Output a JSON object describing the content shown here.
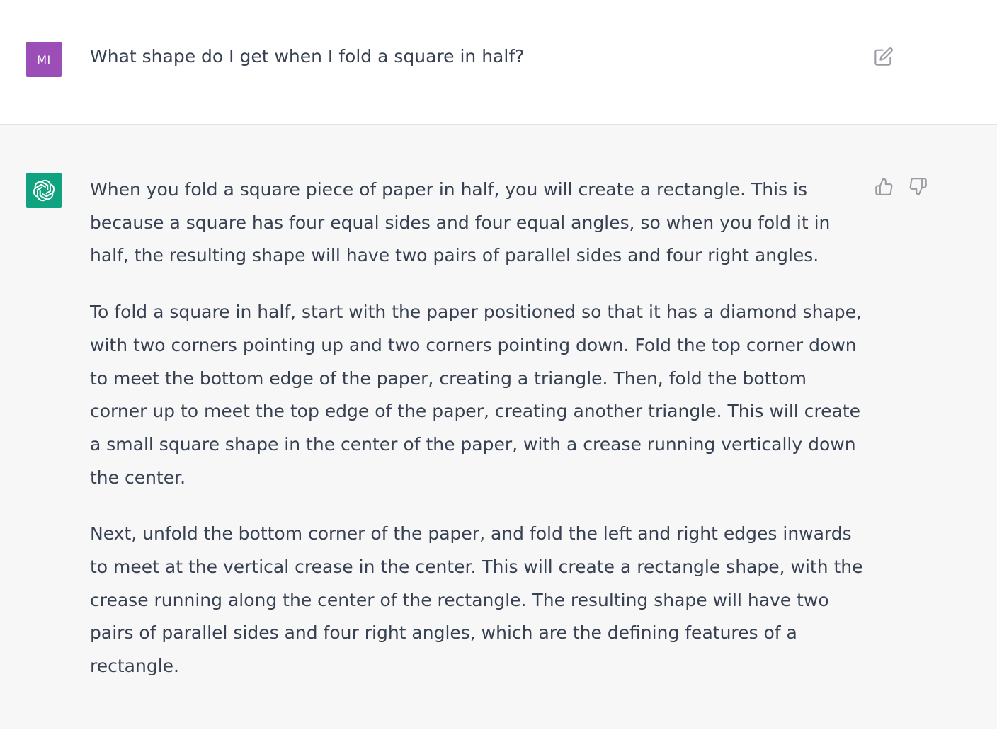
{
  "user_message": {
    "avatar_initials": "MI",
    "avatar_color": "#9b4fb6",
    "text": "What shape do I get when I fold a square in half?",
    "edit_icon": "edit-icon"
  },
  "assistant_message": {
    "avatar_color": "#10a37f",
    "avatar_icon": "openai-logo-icon",
    "paragraphs": [
      "When you fold a square piece of paper in half, you will create a rectangle. This is because a square has four equal sides and four equal angles, so when you fold it in half, the resulting shape will have two pairs of parallel sides and four right angles.",
      "To fold a square in half, start with the paper positioned so that it has a diamond shape, with two corners pointing up and two corners pointing down. Fold the top corner down to meet the bottom edge of the paper, creating a triangle. Then, fold the bottom corner up to meet the top edge of the paper, creating another triangle. This will create a small square shape in the center of the paper, with a crease running vertically down the center.",
      "Next, unfold the bottom corner of the paper, and fold the left and right edges inwards to meet at the vertical crease in the center. This will create a rectangle shape, with the crease running along the center of the rectangle. The resulting shape will have two pairs of parallel sides and four right angles, which are the defining features of a rectangle."
    ],
    "feedback_icons": [
      "thumbs-up-icon",
      "thumbs-down-icon"
    ]
  }
}
